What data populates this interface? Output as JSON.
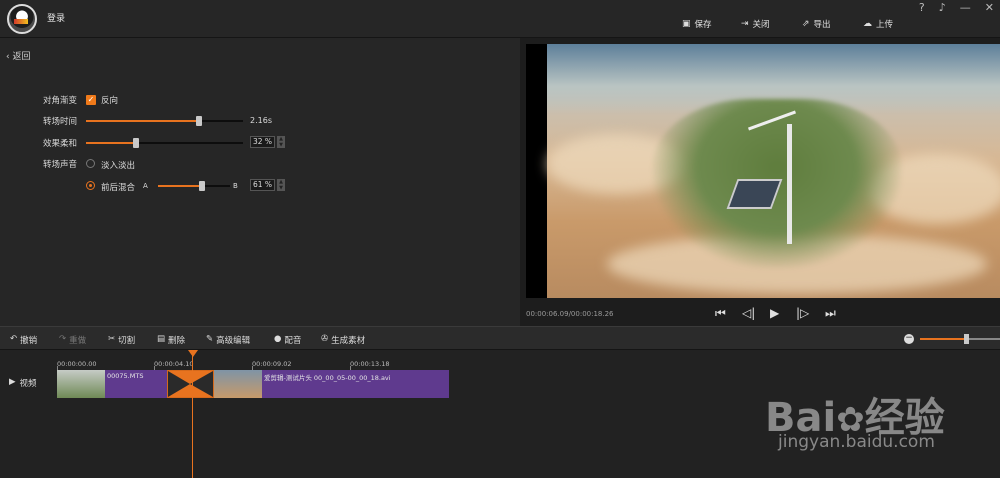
{
  "header": {
    "login": "登录",
    "toolbar": [
      {
        "label": "保存",
        "icon": "save-icon"
      },
      {
        "label": "关闭",
        "icon": "exit-icon"
      },
      {
        "label": "导出",
        "icon": "export-icon"
      },
      {
        "label": "上传",
        "icon": "cloud-upload-icon"
      }
    ],
    "system": [
      "?",
      "♫",
      "—",
      "✕"
    ]
  },
  "left": {
    "back": "返回",
    "diagonal_gradient_label": "对角渐变",
    "reverse_label": "反向",
    "reverse_checked": true,
    "transition_time_label": "转场时间",
    "transition_time_value": "2.16s",
    "transition_time_fraction": 0.72,
    "softness_label": "效果柔和",
    "softness_value": "32 %",
    "softness_fraction": 0.32,
    "audio_label": "转场声音",
    "fade_label": "淡入淡出",
    "mix_label": "前后混合",
    "mix_a": "A",
    "mix_b": "B",
    "mix_value": "61 %",
    "mix_fraction": 0.61
  },
  "preview": {
    "timecode": "00:00:06.09/00:00:18.26"
  },
  "edit_toolbar": [
    {
      "label": "撤销",
      "icon": "undo-icon",
      "enabled": true
    },
    {
      "label": "重做",
      "icon": "redo-icon",
      "enabled": false
    },
    {
      "label": "切割",
      "icon": "scissors-icon",
      "enabled": true
    },
    {
      "label": "删除",
      "icon": "trash-icon",
      "enabled": true
    },
    {
      "label": "高级编辑",
      "icon": "pencil-icon",
      "enabled": true
    },
    {
      "label": "配音",
      "icon": "microphone-icon",
      "enabled": true
    },
    {
      "label": "生成素材",
      "icon": "film-reel-icon",
      "enabled": true
    }
  ],
  "timeline": {
    "ticks": [
      "00:00:00.00",
      "00:00:04.10",
      "00:00:09.02",
      "00:00:13.18"
    ],
    "track_label": "视频",
    "clip1_name": "00075.MTS",
    "clip2_name": "爱剪辑-测试片头 00_00_05-00_00_18.avi"
  },
  "watermark": {
    "logo": "Bai du 经验",
    "url": "jingyan.baidu.com"
  }
}
